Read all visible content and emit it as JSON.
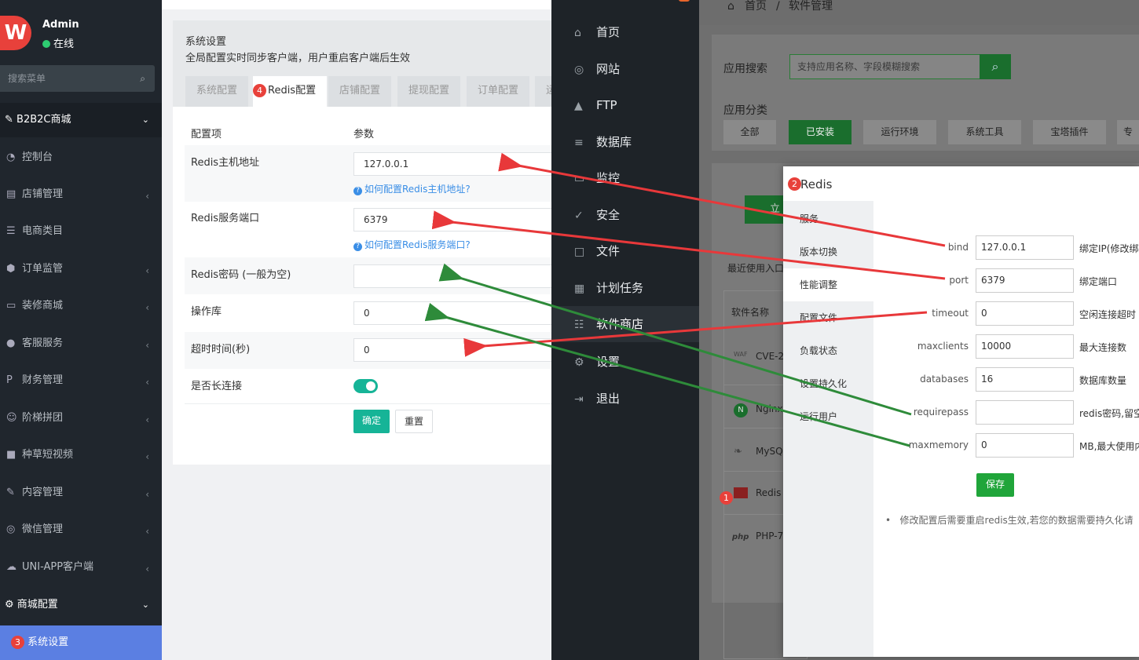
{
  "sidebar": {
    "logo": "W",
    "user": "Admin",
    "status": "在线",
    "search_placeholder": "搜索菜单",
    "group1": "B2B2C商城",
    "items": [
      "控制台",
      "店铺管理",
      "电商类目",
      "订单监管",
      "装修商城",
      "客服服务",
      "财务管理",
      "阶梯拼团",
      "种草短视频",
      "内容管理",
      "微信管理",
      "UNI-APP客户端"
    ],
    "group2": "商城配置",
    "active_badge": "3",
    "active_item": "系统设置"
  },
  "settings": {
    "title": "系统设置",
    "subtitle": "全局配置实时同步客户端，用户重启客户端后生效",
    "tabs": [
      "系统配置",
      "Redis配置",
      "店铺配置",
      "提现配置",
      "订单配置",
      "运"
    ],
    "tab_badge": "4",
    "col1": "配置项",
    "col2": "参数",
    "rows": [
      {
        "label": "Redis主机地址",
        "value": "127.0.0.1",
        "help": "如何配置Redis主机地址?"
      },
      {
        "label": "Redis服务端口",
        "value": "6379",
        "help": "如何配置Redis服务端口?"
      },
      {
        "label": "Redis密码 (一般为空)",
        "value": ""
      },
      {
        "label": "操作库",
        "value": "0"
      },
      {
        "label": "超时时间(秒)",
        "value": "0"
      },
      {
        "label": "是否长连接",
        "value": ""
      }
    ],
    "confirm": "确定",
    "reset": "重置"
  },
  "darknav": {
    "items": [
      "首页",
      "网站",
      "FTP",
      "数据库",
      "监控",
      "安全",
      "文件",
      "计划任务",
      "软件商店",
      "设置",
      "退出"
    ]
  },
  "bt": {
    "breadcrumb_home": "首页",
    "breadcrumb_sep": "/",
    "breadcrumb_page": "软件管理",
    "search_label": "应用搜索",
    "search_placeholder": "支持应用名称、字段模糊搜索",
    "category_label": "应用分类",
    "categories": [
      "全部",
      "已安装",
      "运行环境",
      "系统工具",
      "宝塔插件",
      "专"
    ],
    "recent": "最近使用入口",
    "install_btn": "立",
    "col_name": "软件名称",
    "apps": [
      "CVE-2",
      "Nginx",
      "MySQL",
      "Redis",
      "PHP-7"
    ],
    "app_icon_labels": [
      "WAF",
      "N",
      "",
      "",
      "php"
    ],
    "redis_badge": "1"
  },
  "dialog": {
    "badge": "2",
    "title": "Redis",
    "side": [
      "服务",
      "版本切换",
      "性能调整",
      "配置文件",
      "负载状态",
      "设置持久化",
      "运行用户"
    ],
    "fields": [
      {
        "key": "bind",
        "value": "127.0.0.1",
        "desc": "绑定IP(修改绑"
      },
      {
        "key": "port",
        "value": "6379",
        "desc": "绑定端口"
      },
      {
        "key": "timeout",
        "value": "0",
        "desc": "空闲连接超时"
      },
      {
        "key": "maxclients",
        "value": "10000",
        "desc": "最大连接数"
      },
      {
        "key": "databases",
        "value": "16",
        "desc": "数据库数量"
      },
      {
        "key": "requirepass",
        "value": "",
        "desc": "redis密码,留空"
      },
      {
        "key": "maxmemory",
        "value": "0",
        "desc": "MB,最大使用内"
      }
    ],
    "save": "保存",
    "note": "修改配置后需要重启redis生效,若您的数据需要持久化请"
  },
  "colors": {
    "red_arrow": "#e8383a",
    "green_arrow": "#2e8b3a",
    "teal": "#16b497",
    "active_menu": "#5b7fe2",
    "bt_green": "#20a53a"
  }
}
